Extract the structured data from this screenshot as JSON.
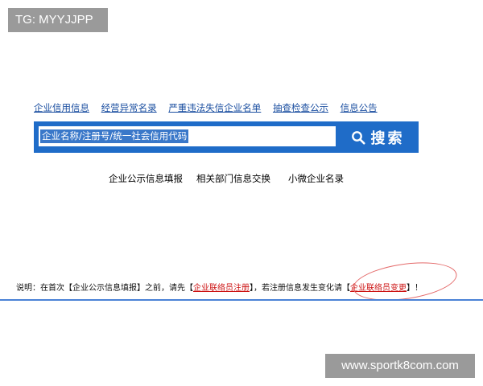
{
  "watermark_top": "TG: MYYJJPP",
  "top_nav": {
    "items": [
      {
        "label": "企业信用信息"
      },
      {
        "label": "经营异常名录"
      },
      {
        "label": "严重违法失信企业名单"
      },
      {
        "label": "抽查检查公示"
      },
      {
        "label": "信息公告"
      }
    ]
  },
  "search": {
    "value": "企业名称/注册号/统一社会信用代码",
    "button_label": "搜索",
    "icon": "search-icon"
  },
  "sub_nav": {
    "items": [
      {
        "label": "企业公示信息填报"
      },
      {
        "label": "相关部门信息交换"
      },
      {
        "label": "小微企业名录"
      }
    ]
  },
  "notice": {
    "prefix": "说明：在首次【企业公示信息填报】之前，请先【",
    "link1": "企业联络员注册",
    "middle": "】，若注册信息发生变化请【",
    "link2": "企业联络员变更",
    "suffix": "】！"
  },
  "colors": {
    "accent": "#1f6cc8",
    "link": "#1a4ea0",
    "notice_link": "#cc1111",
    "annotation": "#e46a6a"
  },
  "watermark_bottom": "www.sportk8com.com"
}
